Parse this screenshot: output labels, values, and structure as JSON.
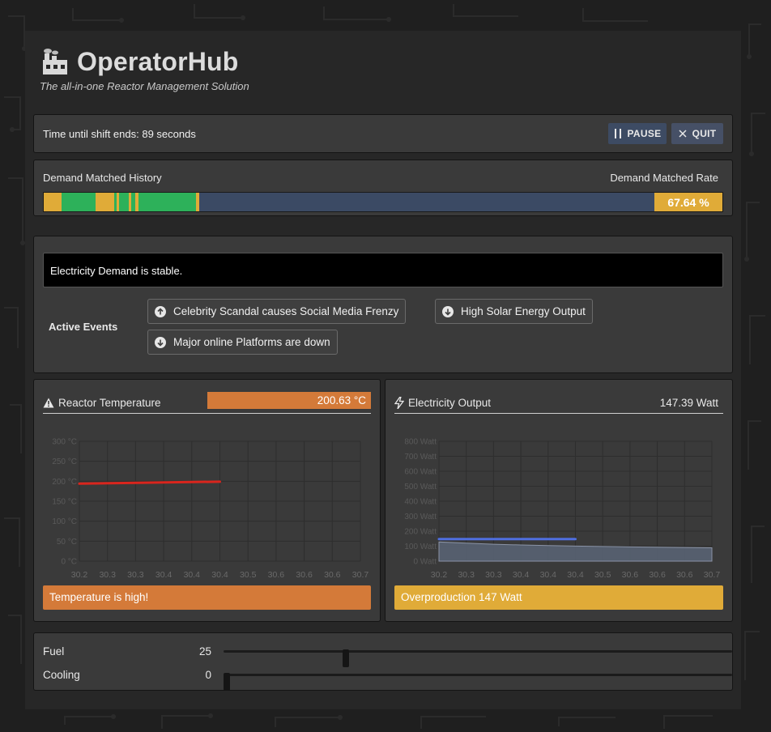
{
  "app": {
    "title": "OperatorHub",
    "subtitle": "The all-in-one Reactor Management Solution",
    "logo_icon": "factory-icon"
  },
  "shift": {
    "text": "Time until shift ends: 89 seconds",
    "pause_label": "PAUSE",
    "quit_label": "QUIT"
  },
  "demand": {
    "history_label": "Demand Matched History",
    "rate_label": "Demand Matched Rate",
    "rate_value": "67.64 %",
    "history_segments": [
      {
        "status": "partial",
        "start": 0.0,
        "end": 0.026
      },
      {
        "status": "matched",
        "start": 0.026,
        "end": 0.076
      },
      {
        "status": "partial",
        "start": 0.076,
        "end": 0.104
      },
      {
        "status": "matched",
        "start": 0.104,
        "end": 0.107
      },
      {
        "status": "partial",
        "start": 0.107,
        "end": 0.111
      },
      {
        "status": "matched",
        "start": 0.111,
        "end": 0.125
      },
      {
        "status": "partial",
        "start": 0.125,
        "end": 0.129
      },
      {
        "status": "matched",
        "start": 0.129,
        "end": 0.135
      },
      {
        "status": "partial",
        "start": 0.135,
        "end": 0.14
      },
      {
        "status": "matched",
        "start": 0.14,
        "end": 0.224
      },
      {
        "status": "partial",
        "start": 0.224,
        "end": 0.229
      }
    ],
    "colors": {
      "matched": "#2db15a",
      "partial": "#e0ab38",
      "empty": "#3b4a64"
    }
  },
  "events": {
    "status": "Electricity Demand is stable.",
    "active_label": "Active Events",
    "items": [
      {
        "label": "Celebrity Scandal causes Social Media Frenzy",
        "direction": "up"
      },
      {
        "label": "High Solar Energy Output",
        "direction": "down"
      },
      {
        "label": "Major online Platforms are down",
        "direction": "down"
      }
    ]
  },
  "temperature": {
    "title": "Reactor Temperature",
    "value": "200.63  °C",
    "alert": "Temperature is high!",
    "icon": "warning-icon"
  },
  "electricity": {
    "title": "Electricity Output",
    "value": "147.39  Watt",
    "alert": "Overproduction 147 Watt",
    "icon": "bolt-icon"
  },
  "controls": {
    "fuel": {
      "label": "Fuel",
      "value": "25",
      "fraction": 0.25
    },
    "cooling": {
      "label": "Cooling",
      "value": "0",
      "fraction": 0.0
    }
  },
  "chart_data": [
    {
      "type": "line",
      "title": "",
      "x_ticks": [
        "30.2",
        "30.3",
        "30.3",
        "30.4",
        "30.4",
        "30.4",
        "30.5",
        "30.6",
        "30.6",
        "30.6",
        "30.7"
      ],
      "y_ticks": [
        "0 °C",
        "50 °C",
        "100 °C",
        "150 °C",
        "200 °C",
        "250 °C",
        "300 °C"
      ],
      "ylim": [
        0,
        300
      ],
      "grid": true,
      "series": [
        {
          "color": "#d9251d",
          "x_index": [
            0,
            5
          ],
          "values": [
            194,
            199
          ]
        }
      ]
    },
    {
      "type": "area",
      "title": "",
      "x_ticks": [
        "30.2",
        "30.3",
        "30.3",
        "30.4",
        "30.4",
        "30.4",
        "30.5",
        "30.6",
        "30.6",
        "30.6",
        "30.7"
      ],
      "y_ticks": [
        "0 Watt",
        "100 Watt",
        "200 Watt",
        "300 Watt",
        "400 Watt",
        "500 Watt",
        "600 Watt",
        "700 Watt",
        "800 Watt"
      ],
      "ylim": [
        0,
        800
      ],
      "grid": true,
      "series": [
        {
          "type": "line",
          "color": "#4f6fe0",
          "x_index": [
            0,
            5
          ],
          "values": [
            147,
            147
          ]
        },
        {
          "type": "area",
          "color": "#5b6577",
          "x_index": [
            0,
            1,
            2,
            3,
            4,
            5,
            6,
            7,
            8,
            9,
            10
          ],
          "values": [
            128,
            120,
            113,
            108,
            104,
            101,
            98,
            95,
            93,
            91,
            89
          ]
        }
      ]
    }
  ]
}
